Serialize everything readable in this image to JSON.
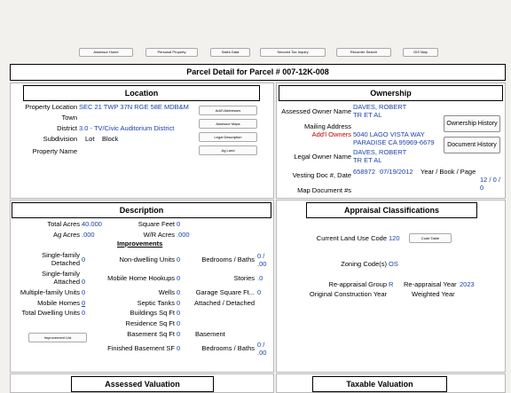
{
  "nav": [
    "Assessor Home",
    "Personal Property",
    "Sales Data",
    "Secured Tax Inquiry",
    "Recorder Search",
    "GIS Map"
  ],
  "title": "Parcel Detail for Parcel #  007-12K-008",
  "location": {
    "heading": "Location",
    "property_location_label": "Property Location",
    "property_location_value": "SEC 21 TWP 37N RGE 58E MDB&M",
    "town_label": "Town",
    "district_label": "District",
    "district_value": "3.0 - TV/Civic Auditorium District",
    "subdivision_label": "Subdivision",
    "lot_label": "Lot",
    "block_label": "Block",
    "property_name_label": "Property Name",
    "buttons": [
      "Add'l Addresses",
      "Assessor Maps",
      "Legal Description",
      "Ag Land"
    ]
  },
  "ownership": {
    "heading": "Ownership",
    "assessed_owner_label": "Assessed Owner Name",
    "assessed_owner_value": "DAVES, ROBERT TR ET AL",
    "mailing_label": "Mailing Address",
    "addl_owners_label": "Add'l Owners",
    "mailing_line1": "5040 LAGO VISTA WAY",
    "mailing_line2": "PARADISE CA 95969-6679",
    "legal_owner_label": "Legal Owner Name",
    "legal_owner_value": "DAVES, ROBERT TR ET AL",
    "vesting_label": "Vesting Doc #, Date",
    "vesting_doc": "658972",
    "vesting_date": "07/19/2012",
    "year_book_page_label": "Year / Book / Page",
    "year_book_page_value": "12 / 0 / 0",
    "map_doc_label": "Map Document #s",
    "history_button": "Ownership History",
    "document_button": "Document History"
  },
  "description": {
    "heading": "Description",
    "total_acres_label": "Total Acres",
    "total_acres_value": "40.000",
    "sqft_label": "Square Feet",
    "sqft_value": "0",
    "ag_acres_label": "Ag Acres",
    "ag_acres_value": ".000",
    "wr_acres_label": "W/R Acres",
    "wr_acres_value": ".000",
    "improvements_label": "Improvements",
    "sfd_label": "Single-family Detached",
    "sfd_value": "0",
    "nondwelling_label": "Non-dwelling Units",
    "nondwelling_value": "0",
    "bed_bath_label": "Bedrooms / Baths",
    "bed_bath_1": "0 / .00",
    "sfa_label": "Single-family Attached",
    "sfa_value": "0",
    "mh_hookups_label": "Mobile Home Hookups",
    "mh_hookups_value": "0",
    "stories_label": "Stories",
    "stories_value": ".0",
    "multi_label": "Multiple-family Units",
    "multi_value": "0",
    "wells_label": "Wells",
    "wells_value": "0",
    "garage_label": "Garage Square Ft...",
    "garage_value": "0",
    "mobile_label": "Mobile Homes",
    "mobile_value": "0",
    "septic_label": "Septic Tanks",
    "septic_value": "0",
    "attached_label": "Attached / Detached",
    "dwelling_label": "Total Dwelling Units",
    "dwelling_value": "0",
    "bldg_sqft_label": "Buildings Sq Ft",
    "bldg_sqft_value": "0",
    "res_sqft_label": "Residence Sq Ft",
    "res_sqft_value": "0",
    "basement_sqft_label": "Basement Sq Ft",
    "basement_sqft_value": "0",
    "basement_label": "Basement",
    "fin_basement_label": "Finished Basement SF",
    "fin_basement_value": "0",
    "bed_bath_2": "0 / .00",
    "improvement_button": "Improvement List"
  },
  "appraisal": {
    "heading": "Appraisal Classifications",
    "land_use_label": "Current Land Use Code",
    "land_use_value": "120",
    "code_table_button": "Code Table",
    "zoning_label": "Zoning Code(s)",
    "zoning_value": "OS",
    "reappraisal_group_label": "Re-appraisal Group",
    "reappraisal_group_value": "R",
    "reappraisal_year_label": "Re-appraisal Year",
    "reappraisal_year_value": "2023",
    "orig_year_label": "Original Construction Year",
    "weighted_year_label": "Weighted Year"
  },
  "bottom": {
    "assessed_heading": "Assessed Valuation",
    "taxable_heading": "Taxable Valuation"
  }
}
